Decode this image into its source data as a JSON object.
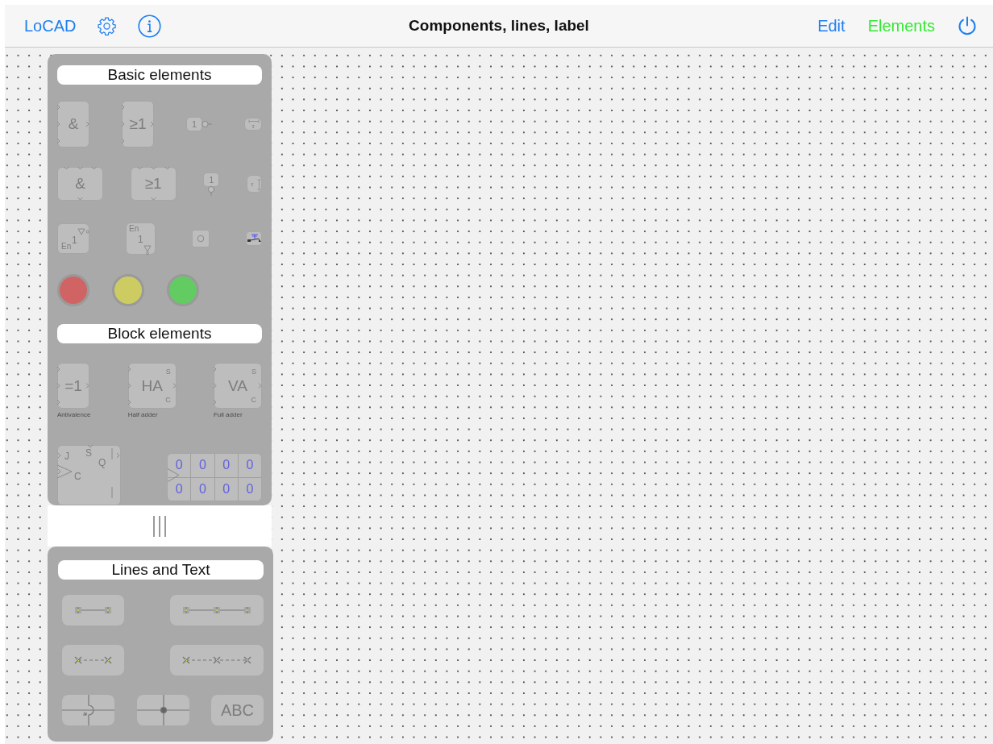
{
  "toolbar": {
    "app_name": "LoCAD",
    "title": "Components, lines, label",
    "buttons": [
      {
        "label": "Edit",
        "selected": false
      },
      {
        "label": "Elements",
        "selected": true
      }
    ]
  },
  "palettes": [
    {
      "title": "Basic elements",
      "rows": [
        [
          {
            "kind": "gate",
            "symbol": "&"
          },
          {
            "kind": "gate",
            "symbol": "≥1"
          },
          {
            "kind": "inverter",
            "symbol": "1"
          },
          {
            "kind": "delay",
            "symbol": "τ"
          }
        ],
        [
          {
            "kind": "gate-wide",
            "symbol": "&"
          },
          {
            "kind": "gate-wide",
            "symbol": "≥1"
          },
          {
            "kind": "inverter-down",
            "symbol": "1"
          },
          {
            "kind": "delay-down",
            "symbol": "τ"
          }
        ],
        [
          {
            "kind": "enable",
            "symbol": "1",
            "enable": "En"
          },
          {
            "kind": "enable-down",
            "symbol": "1",
            "enable": "En"
          },
          {
            "kind": "pushbutton"
          },
          {
            "kind": "switch"
          }
        ],
        [
          {
            "kind": "lamp",
            "color": "#d06464"
          },
          {
            "kind": "lamp",
            "color": "#cccc62"
          },
          {
            "kind": "lamp",
            "color": "#62cc62"
          }
        ]
      ]
    },
    {
      "title": "Block elements",
      "rows": [
        [
          {
            "kind": "block",
            "symbol": "=1",
            "caption": "Antivalence"
          },
          {
            "kind": "block",
            "symbol": "HA",
            "outputs": [
              "S",
              "C"
            ],
            "caption": "Half adder"
          },
          {
            "kind": "block",
            "symbol": "VA",
            "outputs": [
              "S",
              "C"
            ],
            "caption": "Full adder"
          }
        ],
        [
          {
            "kind": "flipflop",
            "labels": {
              "j": "J",
              "s": "S",
              "c": "C",
              "q": "Q"
            }
          },
          "",
          {
            "kind": "register",
            "values": [
              [
                "0",
                "0",
                "0",
                "0"
              ],
              [
                "0",
                "0",
                "0",
                "0"
              ]
            ]
          }
        ]
      ]
    }
  ],
  "lines_palette": {
    "title": "Lines and Text",
    "rows": [
      [
        {
          "kind": "line"
        },
        {
          "kind": "polyline"
        }
      ],
      [
        {
          "kind": "dashed-line"
        },
        {
          "kind": "dashed-polyline"
        }
      ],
      [
        {
          "kind": "crossing"
        },
        {
          "kind": "junction"
        },
        {
          "kind": "text",
          "label": "ABC"
        }
      ]
    ]
  }
}
